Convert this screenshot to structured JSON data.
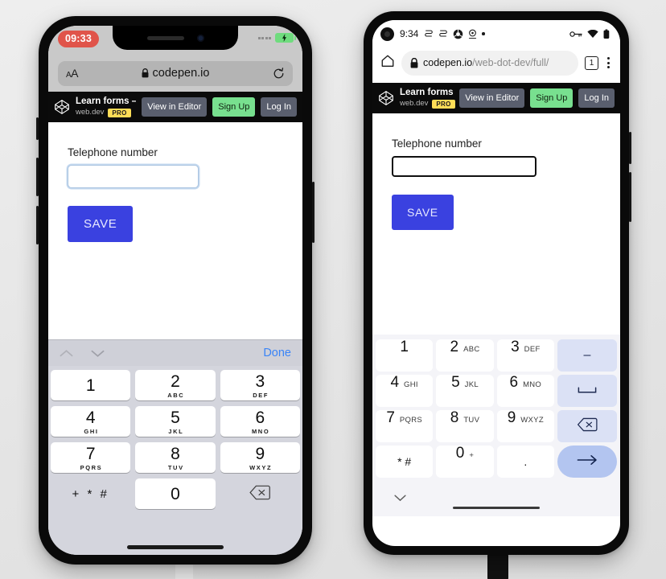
{
  "scene": {
    "description": "Side-by-side mobile browser screenshots showing a telephone number form with the numeric keypad open",
    "background_color": "#e8e8e8"
  },
  "iphone": {
    "device": "iphone",
    "status_bar": {
      "recording_time": "09:33",
      "recording_pill_color": "#e0544a",
      "signal_icon": "signal-dots-icon",
      "battery_icon": "battery-charging-icon",
      "battery_color": "#6fdc7e"
    },
    "browser": {
      "text_size_button": "AA",
      "lock_icon": "lock-icon",
      "url": "codepen.io",
      "reload_icon": "reload-icon"
    },
    "codepen_header": {
      "logo_icon": "codepen-logo-icon",
      "title": "Learn forms – virt...",
      "author": "web.dev",
      "badge": "PRO",
      "buttons": [
        {
          "label": "View in Editor",
          "name": "view-in-editor-button",
          "color": "#5a5f6e"
        },
        {
          "label": "Sign Up",
          "name": "sign-up-button",
          "color": "#78e08f"
        },
        {
          "label": "Log In",
          "name": "log-in-button",
          "color": "#5a5f6e"
        }
      ]
    },
    "form": {
      "label": "Telephone number",
      "input_value": "",
      "input_placeholder": "",
      "save_label": "SAVE",
      "save_color": "#3a41e0"
    },
    "keyboard": {
      "accessory": {
        "prev_icon": "chevron-up-icon",
        "next_icon": "chevron-down-icon",
        "done_label": "Done",
        "done_color": "#3a84f7"
      },
      "keys": [
        [
          {
            "num": "1",
            "sub": ""
          },
          {
            "num": "2",
            "sub": "ABC"
          },
          {
            "num": "3",
            "sub": "DEF"
          }
        ],
        [
          {
            "num": "4",
            "sub": "GHI"
          },
          {
            "num": "5",
            "sub": "JKL"
          },
          {
            "num": "6",
            "sub": "MNO"
          }
        ],
        [
          {
            "num": "7",
            "sub": "PQRS"
          },
          {
            "num": "8",
            "sub": "TUV"
          },
          {
            "num": "9",
            "sub": "WXYZ"
          }
        ]
      ],
      "bottom_row": {
        "symbols": "+ * #",
        "zero": "0",
        "backspace_icon": "backspace-icon"
      }
    }
  },
  "android": {
    "device": "android",
    "status_bar": {
      "camera_icon": "front-camera-punchhole-icon",
      "clock": "9:34",
      "notification_icons": [
        "skype-icon",
        "skype-icon",
        "chrome-icon",
        "location-icon",
        "more-dot-icon"
      ],
      "right_icons": [
        "vpn-key-icon",
        "wifi-icon",
        "battery-icon"
      ]
    },
    "browser": {
      "home_icon": "home-icon",
      "lock_icon": "lock-icon",
      "url_domain": "codepen.io",
      "url_path": "/web-dot-dev/full/",
      "tab_count": "1",
      "menu_icon": "kebab-menu-icon"
    },
    "codepen_header": {
      "logo_icon": "codepen-logo-icon",
      "title": "Learn forms – virt...",
      "author": "web.dev",
      "badge": "PRO",
      "buttons": [
        {
          "label": "View in Editor",
          "name": "view-in-editor-button",
          "color": "#5a5f6e"
        },
        {
          "label": "Sign Up",
          "name": "sign-up-button",
          "color": "#78e08f"
        },
        {
          "label": "Log In",
          "name": "log-in-button",
          "color": "#5a5f6e"
        }
      ]
    },
    "form": {
      "label": "Telephone number",
      "input_value": "",
      "input_placeholder": "",
      "save_label": "SAVE",
      "save_color": "#3a41e0"
    },
    "keyboard": {
      "rows": [
        {
          "keys": [
            {
              "num": "1",
              "sub": ""
            },
            {
              "num": "2",
              "sub": "ABC"
            },
            {
              "num": "3",
              "sub": "DEF"
            }
          ],
          "func": {
            "label": "–",
            "name": "dash-key",
            "icon": "dash-icon"
          }
        },
        {
          "keys": [
            {
              "num": "4",
              "sub": "GHI"
            },
            {
              "num": "5",
              "sub": "JKL"
            },
            {
              "num": "6",
              "sub": "MNO"
            }
          ],
          "func": {
            "label": "␣",
            "name": "space-key",
            "icon": "space-icon"
          }
        },
        {
          "keys": [
            {
              "num": "7",
              "sub": "PQRS"
            },
            {
              "num": "8",
              "sub": "TUV"
            },
            {
              "num": "9",
              "sub": "WXYZ"
            }
          ],
          "func": {
            "label": "",
            "name": "backspace-key",
            "icon": "backspace-icon"
          }
        }
      ],
      "bottom_row": {
        "symbols": "* #",
        "zero": "0",
        "zero_sub": "+",
        "period": ".",
        "enter_icon": "arrow-right-icon"
      },
      "collapse_icon": "chevron-down-icon"
    }
  }
}
